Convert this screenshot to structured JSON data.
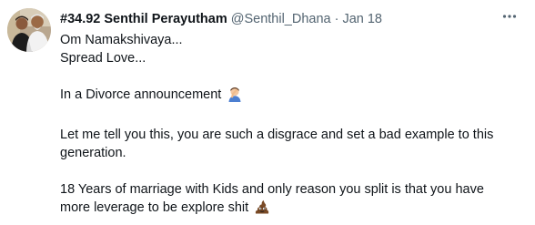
{
  "tweet": {
    "display_name": "#34.92 Senthil Perayutham",
    "handle": "@Senthil_Dhana",
    "separator": "·",
    "date": "Jan 18",
    "more_icon": "more-horizontal-icon",
    "lines": [
      "Om Namakshivaya...",
      "Spread Love...",
      "",
      "In a Divorce announcement",
      "",
      "Let me tell you this, you are such a disgrace and set a bad example to this",
      "generation.",
      "",
      "18 Years of marriage with Kids and only reason you split is that you have",
      "more leverage to be explore shit"
    ],
    "emojis": {
      "facepalm": "man-facepalming-emoji",
      "poop": "pile-of-poo-emoji"
    }
  },
  "colors": {
    "text": "#0f1419",
    "secondary": "#536471",
    "background": "#ffffff"
  }
}
